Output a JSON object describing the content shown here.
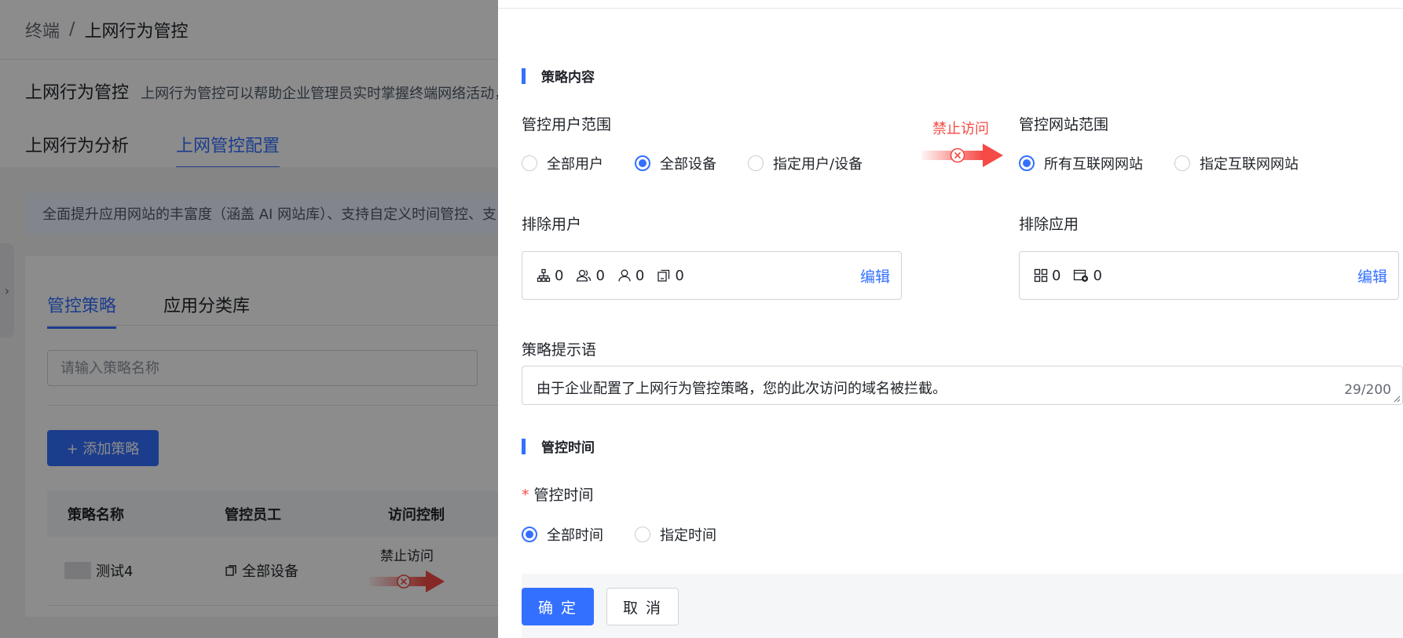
{
  "background": {
    "breadcrumb": {
      "root": "终端",
      "separator": "/",
      "current": "上网行为管控"
    },
    "page_title": "上网行为管控",
    "page_desc": "上网行为管控可以帮助企业管理员实时掌握终端网络活动，",
    "tabs": [
      "上网行为分析",
      "上网管控配置"
    ],
    "notice": "全面提升应用网站的丰富度（涵盖 AI 网站库）、支持自定义时间管控、支",
    "sub_tabs": [
      "管控策略",
      "应用分类库"
    ],
    "search_placeholder": "请输入策略名称",
    "add_button": "+ 添加策略",
    "table_headers": [
      "策略名称",
      "管控员工",
      "访问控制"
    ],
    "table_rows": [
      {
        "name": "测试4",
        "employees": "全部设备",
        "access": "禁止访问"
      }
    ]
  },
  "drawer": {
    "section_content_title": "策略内容",
    "user_scope": {
      "label": "管控用户范围",
      "options": [
        "全部用户",
        "全部设备",
        "指定用户/设备"
      ],
      "selected": "全部设备"
    },
    "access_label": "禁止访问",
    "site_scope": {
      "label": "管控网站范围",
      "options": [
        "所有互联网网站",
        "指定互联网网站"
      ],
      "selected": "所有互联网网站"
    },
    "exclude_users": {
      "label": "排除用户",
      "counts": [
        "0",
        "0",
        "0",
        "0"
      ],
      "icons": [
        "org-tree-icon",
        "user-group-icon",
        "user-icon",
        "device-icon"
      ],
      "edit": "编辑"
    },
    "exclude_apps": {
      "label": "排除应用",
      "counts": [
        "0",
        "0"
      ],
      "icons": [
        "app-grid-icon",
        "website-add-icon"
      ],
      "edit": "编辑"
    },
    "prompt": {
      "label": "策略提示语",
      "value": "由于企业配置了上网行为管控策略，您的此次访问的域名被拦截。",
      "counter": "29/200"
    },
    "section_time_title": "管控时间",
    "control_time": {
      "required_mark": "*",
      "label": "管控时间",
      "options": [
        "全部时间",
        "指定时间"
      ],
      "selected": "全部时间"
    },
    "buttons": {
      "confirm": "确 定",
      "cancel": "取 消"
    }
  },
  "colors": {
    "primary": "#3370ff",
    "danger": "#f54a45",
    "overlay": "rgba(0,0,0,0.45)"
  }
}
